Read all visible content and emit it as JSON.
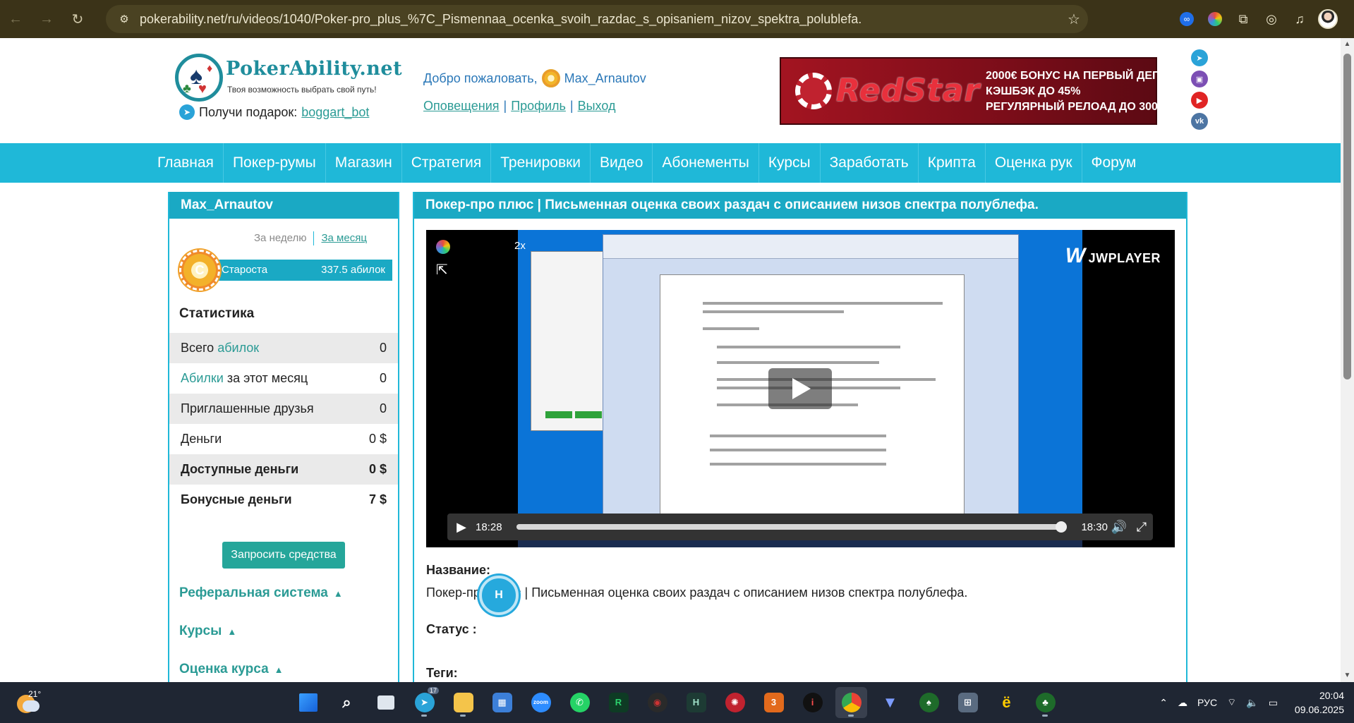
{
  "browser": {
    "url": "pokerability.net/ru/videos/1040/Poker-pro_plus_%7C_Pismennaa_ocenka_svoih_razdac_s_opisaniem_nizov_spektra_polublefa.",
    "back_icon": "arrow-left-icon",
    "forward_icon": "arrow-right-icon",
    "reload_icon": "reload-icon"
  },
  "header": {
    "logo_name": "PokerAbility.net",
    "logo_tagline": "Твоя возможность выбрать свой путь!",
    "gift_text": "Получи подарок:",
    "gift_link": "boggart_bot",
    "welcome_text": "Добро пожаловать,",
    "username": "Max_Arnautov",
    "links": [
      "Оповещения",
      "Профиль",
      "Выход"
    ],
    "banner": {
      "brand": "RedStar",
      "line1": "2000€ БОНУС НА ПЕРВЫЙ ДЕП",
      "line2": "КЭШБЭК ДО 45%",
      "line3": "РЕГУЛЯРНЫЙ РЕЛОАД ДО 300$"
    }
  },
  "nav": [
    "Главная",
    "Покер-румы",
    "Магазин",
    "Стратегия",
    "Тренировки",
    "Видео",
    "Абонементы",
    "Курсы",
    "Заработать",
    "Крипта",
    "Оценка рук",
    "Форум"
  ],
  "sidebar": {
    "title": "Max_Arnautov",
    "period_week": "За неделю",
    "period_month": "За месяц",
    "rank_letter": "C",
    "rank_name": "Староста",
    "rank_value": "337.5 абилок",
    "stats_title": "Статистика",
    "stats": [
      {
        "pre": "Всего ",
        "teal": "абилок",
        "post": "",
        "value": "0"
      },
      {
        "pre": "",
        "teal": "Абилки",
        "post": " за этот месяц",
        "value": "0"
      },
      {
        "pre": "Приглашенные друзья",
        "teal": "",
        "post": "",
        "value": "0"
      },
      {
        "pre": "Деньги",
        "teal": "",
        "post": "",
        "value": "0 $"
      },
      {
        "pre": "Доступные деньги",
        "teal": "",
        "post": "",
        "value": "0 $"
      },
      {
        "pre": "Бонусные деньги",
        "teal": "",
        "post": "",
        "value": "7 $"
      }
    ],
    "request_button": "Запросить средства",
    "sections": [
      "Реферальная система",
      "Курсы",
      "Оценка курса"
    ]
  },
  "main": {
    "title": "Покер-про плюс | Письменная оценка своих раздач с описанием низов спектра полублефа.",
    "player": {
      "speed": "2x",
      "brand": "JWPLAYER",
      "elapsed": "18:28",
      "total": "18:30",
      "progress": 0.99
    },
    "name_label": "Название:",
    "name_value": "Покер-про плюс | Письменная оценка своих раздач с описанием низов спектра полублефа.",
    "status_label": "Статус :",
    "status_badge": "H",
    "tags_label": "Теги:"
  },
  "taskbar": {
    "temperature": "21°",
    "telegram_badge": "17",
    "lang": "РУС",
    "time": "20:04",
    "date": "09.06.2025"
  },
  "colors": {
    "accent": "#1fb8d8",
    "teal": "#2b9b95",
    "chrome": "#3b3318"
  }
}
